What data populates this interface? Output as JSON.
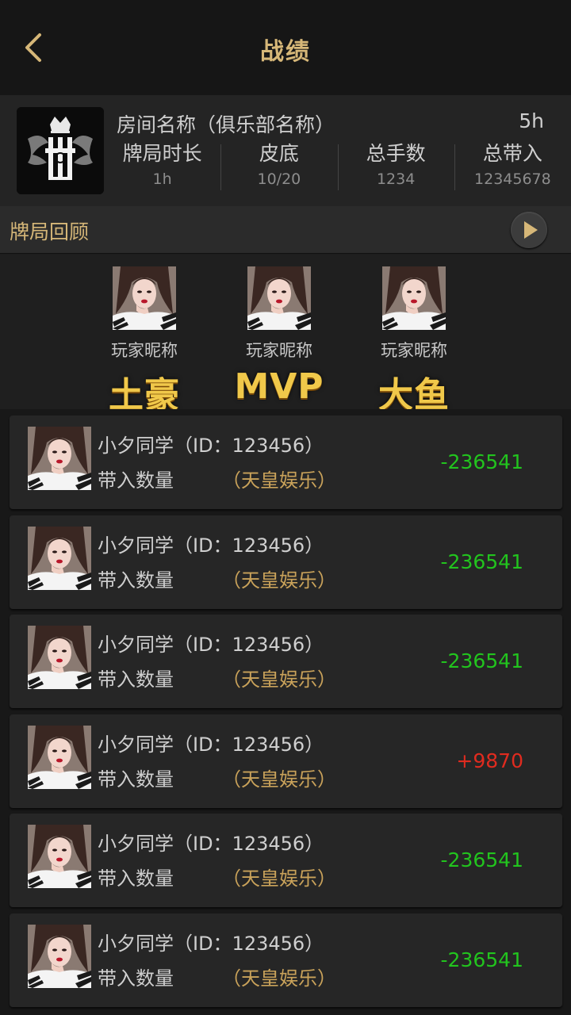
{
  "header": {
    "title": "战绩"
  },
  "room": {
    "name": "房间名称（俱乐部名称）",
    "time": "5h",
    "stats": [
      {
        "label": "牌局时长",
        "value": "1h"
      },
      {
        "label": "皮底",
        "value": "10/20"
      },
      {
        "label": "总手数",
        "value": "1234"
      },
      {
        "label": "总带入",
        "value": "12345678"
      }
    ]
  },
  "review": {
    "label": "牌局回顾"
  },
  "awards": [
    {
      "nickname": "玩家昵称",
      "title": "土豪"
    },
    {
      "nickname": "玩家昵称",
      "title": "MVP"
    },
    {
      "nickname": "玩家昵称",
      "title": "大鱼"
    }
  ],
  "players": [
    {
      "name": "小夕同学（ID：123456）",
      "carry_label": "带入数量",
      "club": "（天皇娱乐）",
      "score": "-236541",
      "score_sign": "negative"
    },
    {
      "name": "小夕同学（ID：123456）",
      "carry_label": "带入数量",
      "club": "（天皇娱乐）",
      "score": "-236541",
      "score_sign": "negative"
    },
    {
      "name": "小夕同学（ID：123456）",
      "carry_label": "带入数量",
      "club": "（天皇娱乐）",
      "score": "-236541",
      "score_sign": "negative"
    },
    {
      "name": "小夕同学（ID：123456）",
      "carry_label": "带入数量",
      "club": "（天皇娱乐）",
      "score": "+9870",
      "score_sign": "positive"
    },
    {
      "name": "小夕同学（ID：123456）",
      "carry_label": "带入数量",
      "club": "（天皇娱乐）",
      "score": "-236541",
      "score_sign": "negative"
    },
    {
      "name": "小夕同学（ID：123456）",
      "carry_label": "带入数量",
      "club": "（天皇娱乐）",
      "score": "-236541",
      "score_sign": "negative"
    }
  ],
  "colors": {
    "gold": "#d6b778",
    "score_negative": "#22c41e",
    "score_positive": "#e02b1f"
  },
  "icons": {
    "back": "chevron-left-icon",
    "play": "play-icon",
    "logo": "club-crest-logo",
    "avatar": "player-avatar"
  }
}
